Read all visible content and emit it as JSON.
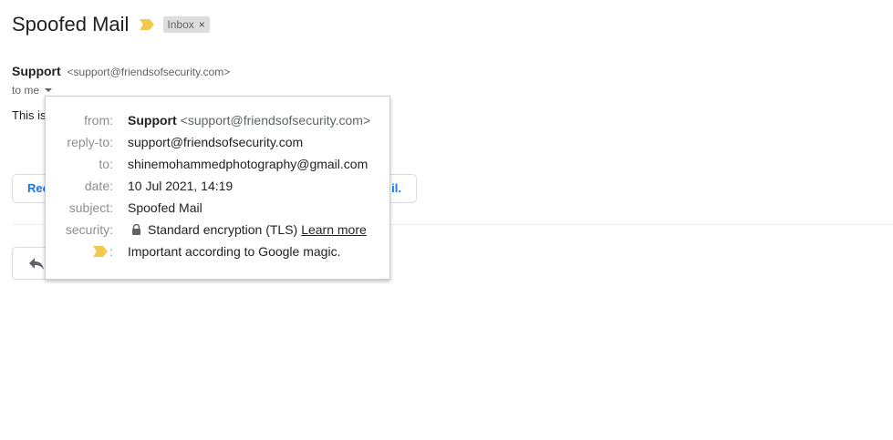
{
  "email": {
    "subject": "Spoofed Mail",
    "label_chip": "Inbox",
    "label_close": "×",
    "sender_name": "Support",
    "sender_email": "<support@friendsofsecurity.com>",
    "to_text": "to me",
    "body_visible": "This is"
  },
  "actions": {
    "left_text": "Rec",
    "right_text": "il."
  },
  "details": {
    "from_label": "from:",
    "from_name": "Support",
    "from_email": "<support@friendsofsecurity.com>",
    "reply_to_label": "reply-to:",
    "reply_to_value": "support@friendsofsecurity.com",
    "to_label": "to:",
    "to_value": "shinemohammedphotography@gmail.com",
    "date_label": "date:",
    "date_value": "10 Jul 2021, 14:19",
    "subject_label": "subject:",
    "subject_value": "Spoofed Mail",
    "security_label": "security:",
    "security_value": "Standard encryption (TLS)",
    "security_link": "Learn more",
    "importance_colon": ":",
    "importance_value": "Important according to Google magic."
  },
  "colors": {
    "importance_marker": "#f2c94c",
    "link_blue": "#1a73e8",
    "chip_bg": "#dddddd"
  },
  "icons": {
    "importance": "importance-marker-icon",
    "lock": "lock-icon",
    "reply": "reply-icon",
    "caret": "caret-down-icon"
  }
}
